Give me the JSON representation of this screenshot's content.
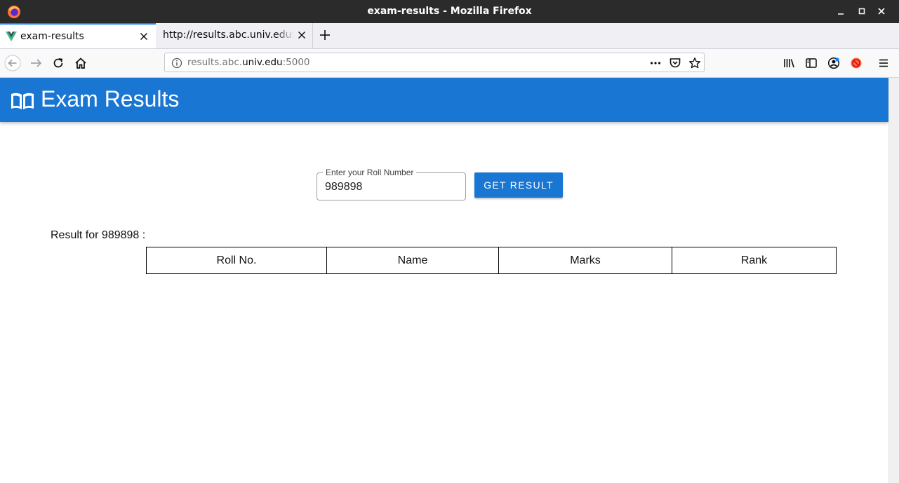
{
  "window": {
    "title": "exam-results - Mozilla Firefox"
  },
  "tabs": [
    {
      "title": "exam-results",
      "active": true,
      "favicon": "vue-logo-icon"
    },
    {
      "title": "http://results.abc.univ.edu:5000",
      "active": false
    }
  ],
  "urlbar": {
    "prefix": "results.abc.",
    "domain": "univ.edu",
    "suffix": ":5000"
  },
  "app": {
    "title": "Exam Results",
    "icon": "open-book-icon",
    "header_color": "#1976d2"
  },
  "form": {
    "label": "Enter your Roll Number",
    "value": "989898",
    "button_label": "GET RESULT"
  },
  "result": {
    "heading": "Result for 989898 :",
    "columns": [
      "Roll No.",
      "Name",
      "Marks",
      "Rank"
    ],
    "rows": []
  }
}
